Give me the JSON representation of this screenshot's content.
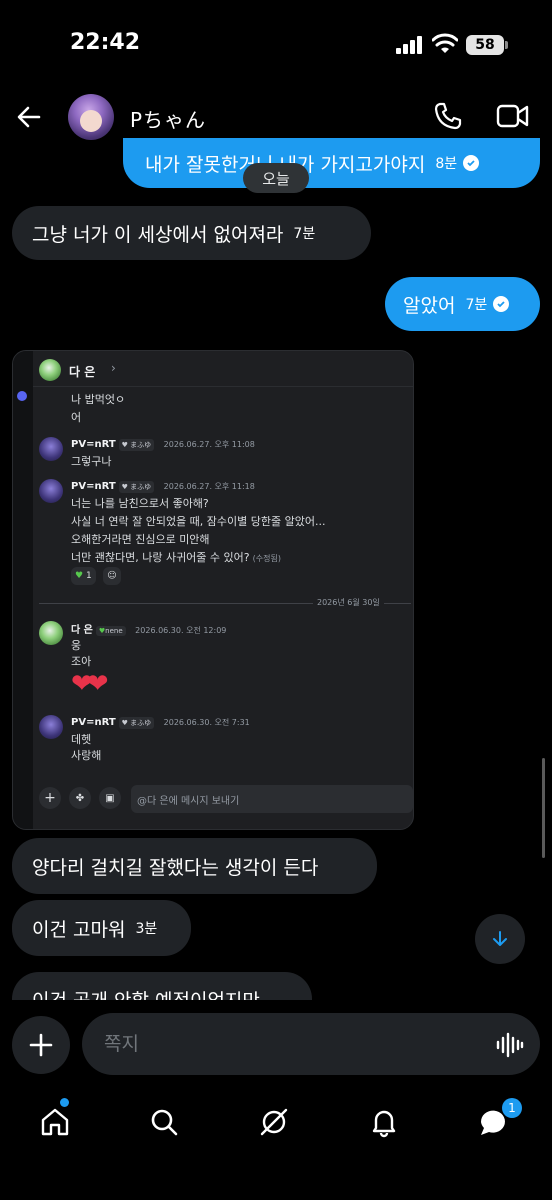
{
  "status_bar": {
    "time": "22:42",
    "battery": "58"
  },
  "header": {
    "contact_name": "Pちゃん"
  },
  "date_separator": "오늘",
  "messages": [
    {
      "text": "내가 잘못한거니 내가 가지고가야지",
      "time": "8분",
      "direction": "outgoing"
    },
    {
      "text": "그냥 너가 이 세상에서 없어져라",
      "time": "7분",
      "direction": "incoming"
    },
    {
      "text": "알았어",
      "time": "7분",
      "direction": "outgoing"
    },
    {
      "text": "양다리 걸치길 잘했다는 생각이 든다",
      "time": "",
      "direction": "incoming"
    },
    {
      "text": "이건 고마워",
      "time": "3분",
      "direction": "incoming"
    },
    {
      "text": "이건 공개 안할 예정이었지만",
      "time": "",
      "direction": "incoming"
    }
  ],
  "attached_screenshot": {
    "channel_name": "다 은",
    "lines": [
      {
        "text": "나 밥먹엇ㅇ"
      },
      {
        "text": "어"
      }
    ],
    "posts": [
      {
        "author": "PV=nRT",
        "tag": "まふゆ",
        "timestamp": "2026.06.27. 오후 11:08",
        "lines": [
          "그렇구나"
        ]
      },
      {
        "author": "PV=nRT",
        "tag": "まふゆ",
        "timestamp": "2026.06.27. 오후 11:18",
        "lines": [
          "너는 나를 남친으로서 좋아해?",
          "사실 너 연락 잘 안되었을 때, 잠수이별 당한줄 알았어...",
          "오해한거라면 진심으로 미안해",
          "너만 괜찮다면, 나랑 사귀어줄 수 있어?"
        ],
        "edited": "(수정됨)",
        "reaction_count": "1"
      },
      {
        "author": "다 은",
        "tag": "nene",
        "timestamp": "2026.06.30. 오전 12:09",
        "lines": [
          "웅",
          "조아"
        ]
      },
      {
        "author": "PV=nRT",
        "tag": "まふゆ",
        "timestamp": "2026.06.30. 오전 7:31",
        "lines": [
          "데헷",
          "사랑해"
        ]
      }
    ],
    "date_divider": "2026년 6월 30일",
    "input_placeholder": "@다  은에 메시지 보내기"
  },
  "composer": {
    "placeholder": "쪽지"
  },
  "nav": {
    "messages_badge": "1"
  },
  "colors": {
    "accent": "#1d9bf0",
    "bubble_incoming": "#202327",
    "background": "#000000"
  }
}
